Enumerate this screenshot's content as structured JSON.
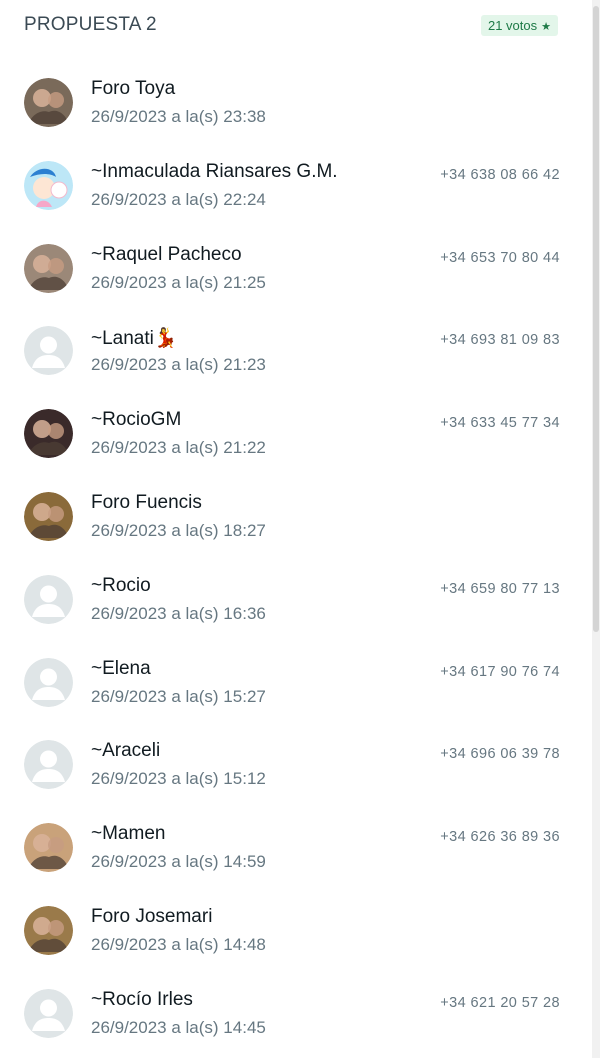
{
  "header": {
    "title": "PROPUESTA 2",
    "votes_label": "21 votos",
    "votes_icon": "star-icon"
  },
  "colors": {
    "accent_green": "#1e7a47",
    "badge_bg": "#e3f6ea",
    "secondary_text": "#667781"
  },
  "voters": [
    {
      "name": "Foro Toya",
      "time": "26/9/2023 a la(s) 23:38",
      "phone": "",
      "avatar": "photo-avatar-couple",
      "avatar_color": "#7a6a5a"
    },
    {
      "name": "~Inmaculada Riansares G.M.",
      "time": "26/9/2023 a la(s) 22:24",
      "phone": "+34 638 08 66 42",
      "avatar": "cartoon-avatar",
      "avatar_color": "#8fd3f4"
    },
    {
      "name": "~Raquel Pacheco",
      "time": "26/9/2023 a la(s) 21:25",
      "phone": "+34 653 70 80 44",
      "avatar": "photo-avatar-selfie",
      "avatar_color": "#9b8878"
    },
    {
      "name": "~Lanati💃",
      "time": "26/9/2023 a la(s) 21:23",
      "phone": "+34 693 81 09 83",
      "avatar": "default-avatar",
      "avatar_color": "#dfe5e7"
    },
    {
      "name": "~RocioGM",
      "time": "26/9/2023 a la(s) 21:22",
      "phone": "+34 633 45 77 34",
      "avatar": "photo-avatar-dark",
      "avatar_color": "#3a2a2a"
    },
    {
      "name": "Foro Fuencis",
      "time": "26/9/2023 a la(s) 18:27",
      "phone": "",
      "avatar": "photo-avatar-group",
      "avatar_color": "#8a6a3a"
    },
    {
      "name": "~Rocio",
      "time": "26/9/2023 a la(s) 16:36",
      "phone": "+34 659 80 77 13",
      "avatar": "default-avatar",
      "avatar_color": "#dfe5e7"
    },
    {
      "name": "~Elena",
      "time": "26/9/2023 a la(s) 15:27",
      "phone": "+34 617 90 76 74",
      "avatar": "default-avatar",
      "avatar_color": "#dfe5e7"
    },
    {
      "name": "~Araceli",
      "time": "26/9/2023 a la(s) 15:12",
      "phone": "+34 696 06 39 78",
      "avatar": "default-avatar",
      "avatar_color": "#dfe5e7"
    },
    {
      "name": "~Mamen",
      "time": "26/9/2023 a la(s) 14:59",
      "phone": "+34 626 36 89 36",
      "avatar": "photo-avatar-woman",
      "avatar_color": "#c9a27a"
    },
    {
      "name": "Foro Josemari",
      "time": "26/9/2023 a la(s) 14:48",
      "phone": "",
      "avatar": "photo-avatar-hat",
      "avatar_color": "#9a7a4a"
    },
    {
      "name": "~Rocío Irles",
      "time": "26/9/2023 a la(s) 14:45",
      "phone": "+34 621 20 57 28",
      "avatar": "default-avatar",
      "avatar_color": "#dfe5e7"
    }
  ]
}
